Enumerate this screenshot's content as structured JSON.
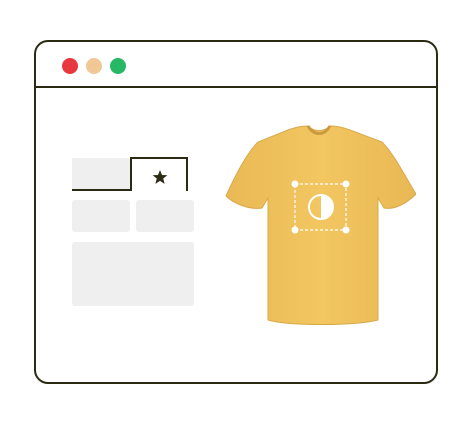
{
  "window": {
    "controls": [
      {
        "name": "close",
        "color": "#e8383f"
      },
      {
        "name": "minimize",
        "color": "#f0c896"
      },
      {
        "name": "maximize",
        "color": "#27b866"
      }
    ]
  },
  "editor": {
    "active_tab_icon": "star-icon",
    "design_icon": "contrast-icon"
  },
  "colors": {
    "outline": "#2b2a12",
    "placeholder": "#efefef",
    "shirt": "#f0c45f"
  }
}
